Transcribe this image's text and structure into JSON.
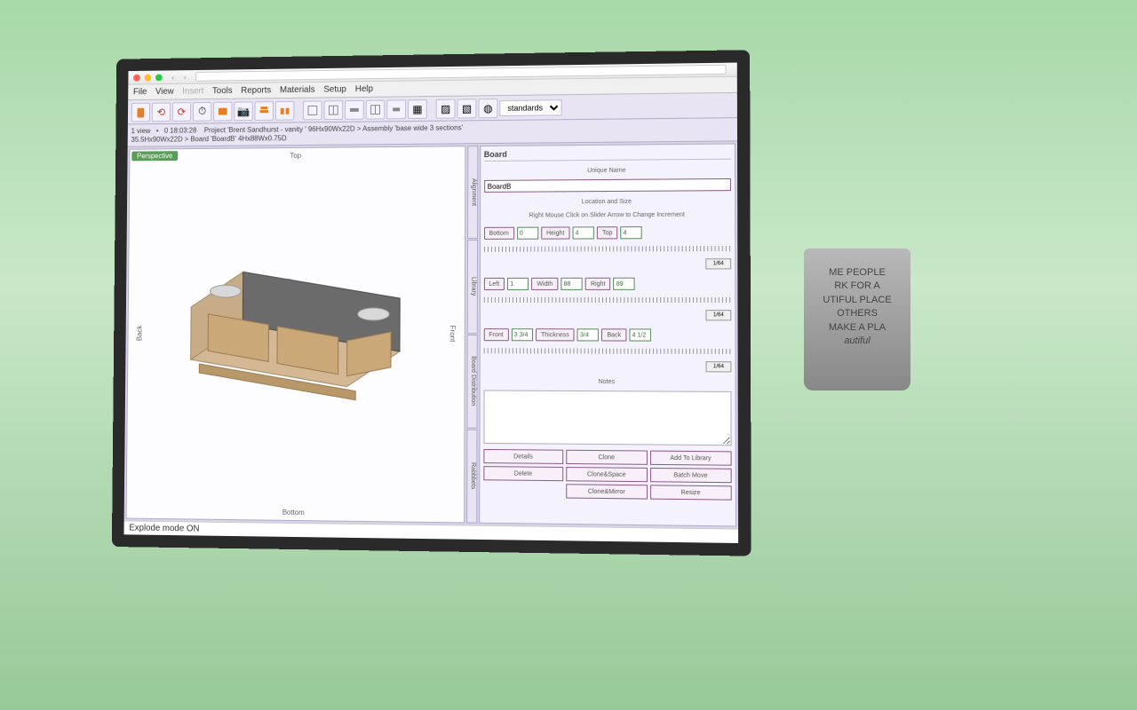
{
  "menu": {
    "file": "File",
    "view": "View",
    "insert": "Insert",
    "tools": "Tools",
    "reports": "Reports",
    "materials": "Materials",
    "setup": "Setup",
    "help": "Help"
  },
  "status": {
    "views": "1 view",
    "timer": "0 18:03:28",
    "breadcrumb1": "Project 'Brent Sandhurst - vanity ' 96Hx90Wx22D > Assembly 'base wide 3 sections'",
    "breadcrumb2": "35.5Hx90Wx22D > Board 'BoardB' 4Hx88Wx0.75D"
  },
  "toolbar_select": "standards",
  "viewport": {
    "mode": "Perspective",
    "top": "Top",
    "bottom": "Bottom",
    "left": "Back",
    "right": "Front"
  },
  "side_tabs": [
    "Alignment",
    "Library",
    "Board Distribution",
    "Rabbbets"
  ],
  "panel": {
    "title": "Board",
    "section_name": "Unique Name",
    "name_value": "BoardB",
    "section_loc": "Location and Size",
    "hint": "Right Mouse Click on Slider Arrow to Change Increment",
    "row1": {
      "l1": "Bottom",
      "v1": "0",
      "l2": "Height",
      "v2": "4",
      "l3": "Top",
      "v3": "4"
    },
    "row2": {
      "l1": "Left",
      "v1": "1",
      "l2": "Width",
      "v2": "88",
      "l3": "Right",
      "v3": "89"
    },
    "row3": {
      "l1": "Front",
      "v1": "3 3/4",
      "l2": "Thickness",
      "v2": "3/4",
      "l3": "Back",
      "v3": "4 1/2"
    },
    "step1": "1/64",
    "step2": "1/64",
    "step3": "1/64",
    "section_notes": "Notes",
    "buttons": {
      "b1": "Details",
      "b2": "Clone",
      "b3": "Add To Library",
      "b4": "Delete",
      "b5": "Clone&Space",
      "b6": "Batch Move",
      "b7": "",
      "b8": "Clone&Mirror",
      "b9": "Resize"
    }
  },
  "bottom_status": "Explode mode ON",
  "pot_lines": [
    "ME PEOPLE",
    "RK FOR A",
    "UTIFUL PLACE",
    "OTHERS",
    "MAKE A PLA",
    "autiful"
  ]
}
